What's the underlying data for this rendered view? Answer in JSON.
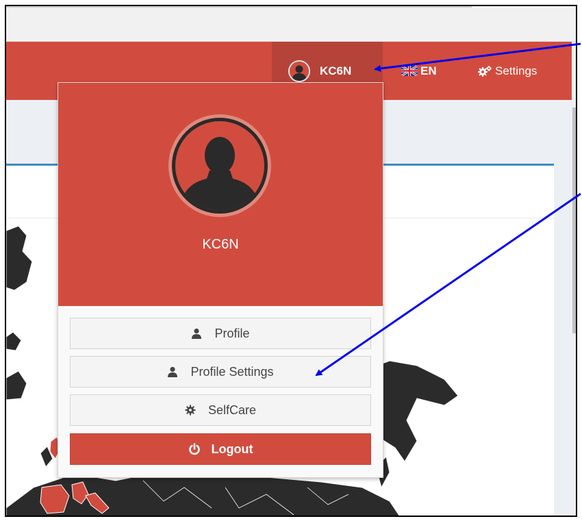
{
  "navbar": {
    "username": "KC6N",
    "language": "EN",
    "settings_label": "Settings",
    "bg_color": "#d14c3e"
  },
  "user_dropdown": {
    "username": "KC6N",
    "header_color": "#d14c3e",
    "items": [
      {
        "label": "Profile",
        "icon": "user-icon"
      },
      {
        "label": "Profile Settings",
        "icon": "user-icon"
      },
      {
        "label": "SelfCare",
        "icon": "gear-icon"
      }
    ],
    "logout": {
      "label": "Logout",
      "icon": "power-icon"
    }
  },
  "annotation_color": "#0000ee"
}
